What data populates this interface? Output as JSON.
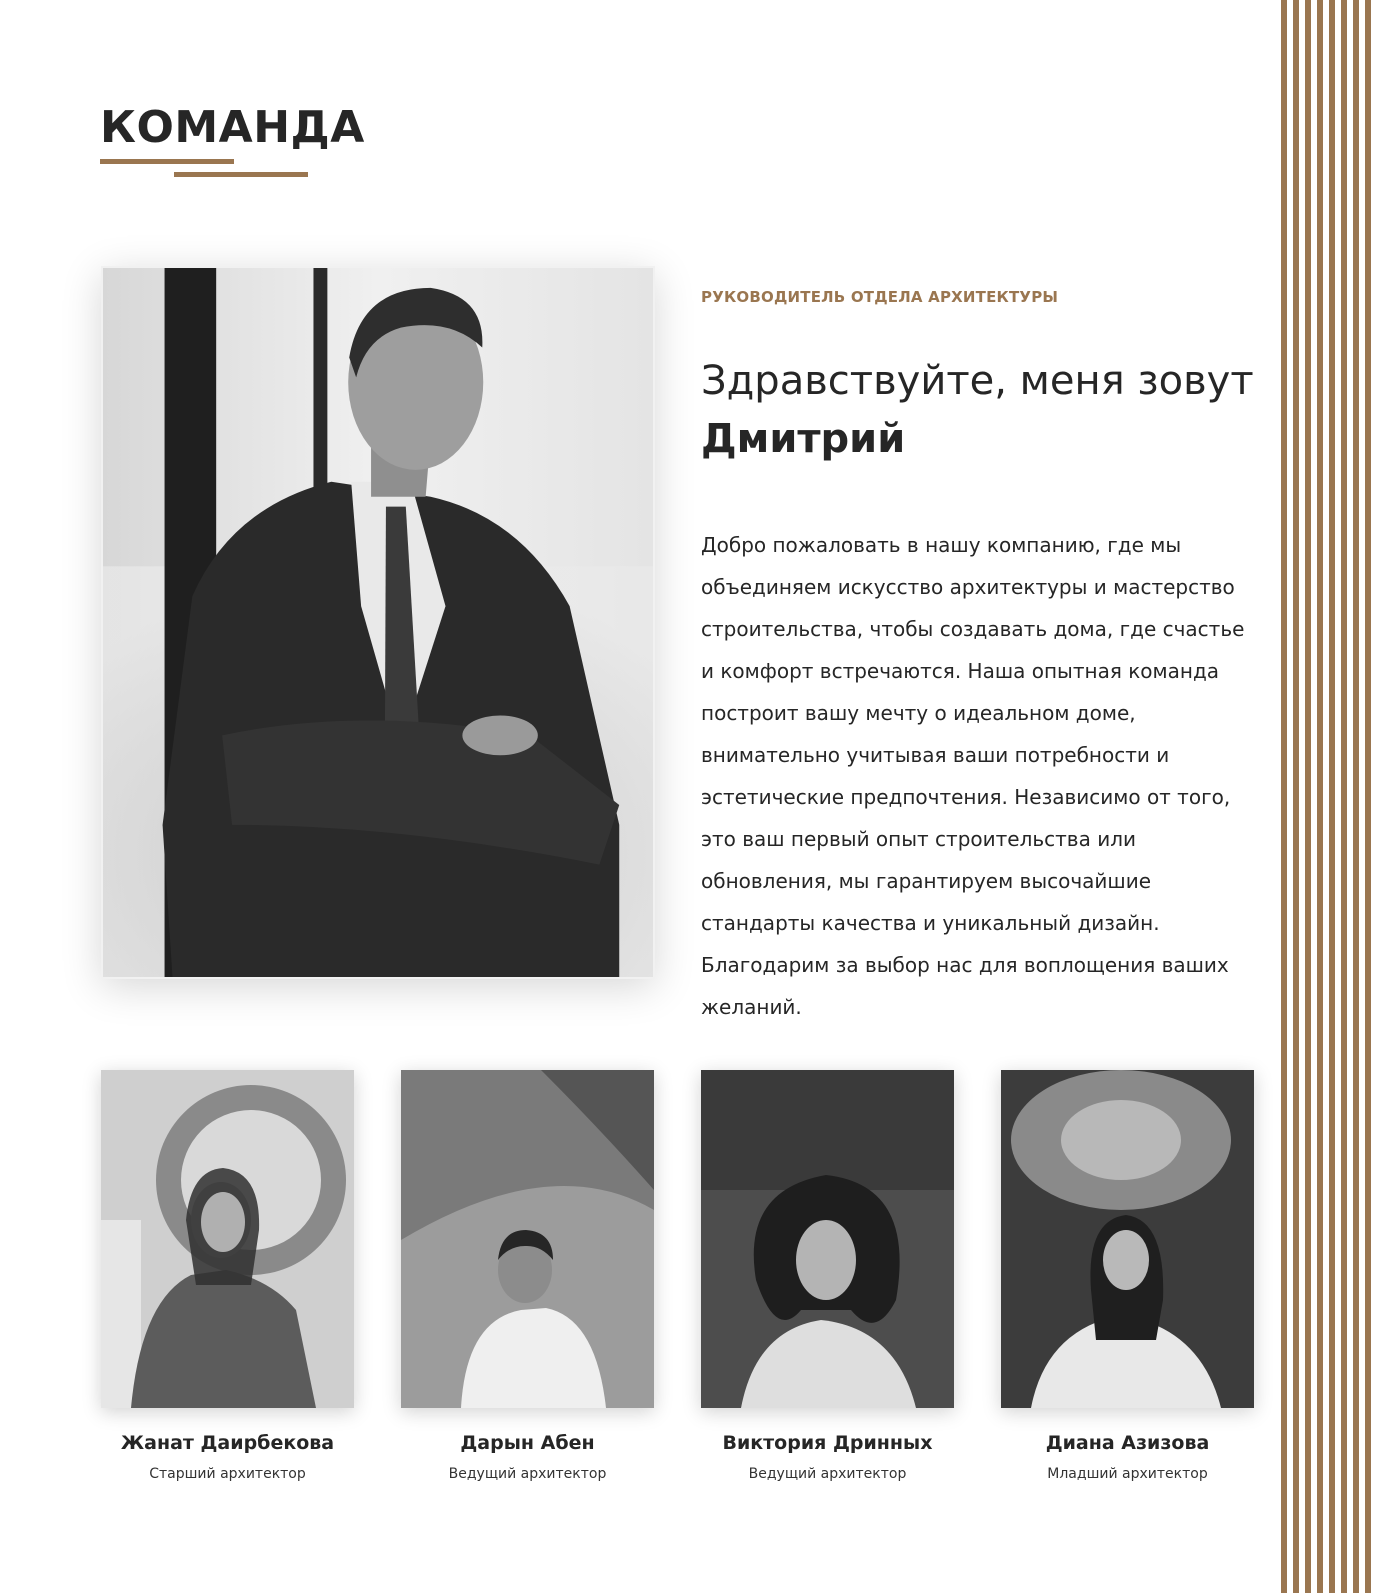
{
  "section": {
    "title": "КОМАНДА"
  },
  "lead": {
    "role": "РУКОВОДИТЕЛЬ ОТДЕЛА АРХИТЕКТУРЫ",
    "greeting": "Здравствуйте, меня зовут",
    "name": "Дмитрий",
    "bio": "Добро пожаловать в нашу компанию, где мы объединяем искусство архитектуры и мастерство строительства, чтобы создавать дома, где счастье и комфорт встречаются. Наша опытная команда построит вашу мечту о идеальном доме, внимательно учитывая ваши потребности и эстетические предпочтения. Независимо от того, это ваш первый опыт строительства или обновления, мы гарантируем высочайшие стандарты качества и уникальный дизайн. Благодарим за выбор нас для воплощения ваших желаний."
  },
  "team": [
    {
      "name": "Жанат Даирбекова",
      "role": "Старший архитектор"
    },
    {
      "name": "Дарын Абен",
      "role": "Ведущий архитектор"
    },
    {
      "name": "Виктория Дринных",
      "role": "Ведущий архитектор"
    },
    {
      "name": "Диана Азизова",
      "role": "Младший архитектор"
    }
  ],
  "colors": {
    "accent": "#9a7650",
    "text": "#262626"
  }
}
